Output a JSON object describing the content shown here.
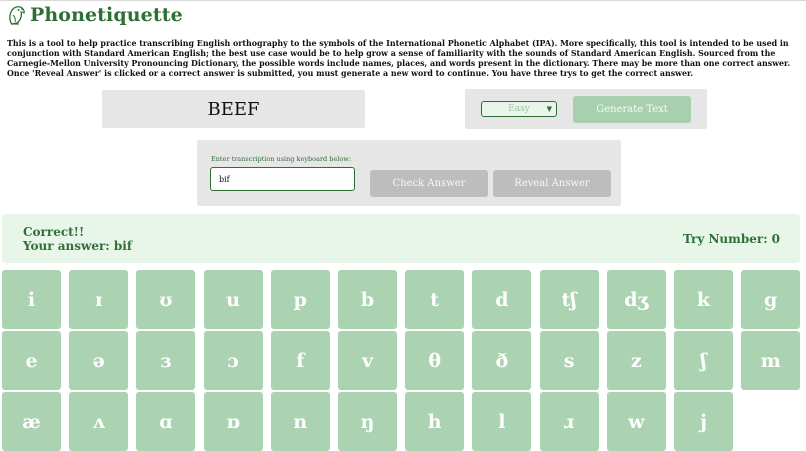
{
  "app": {
    "title": "Phonetiquette"
  },
  "description": "This is a tool to help practice transcribing English orthography to the symbols of the International Phonetic Alphabet (IPA). More specifically, this tool is intended to be used in conjunction with Standard American English; the best use case would be to help grow a sense of familiarity with the sounds of Standard American English. Sourced from the Carnegie-Mellon University Pronouncing Dictionary, the possible words include names, places, and words present in the dictionary. There may be more than one correct answer. Once 'Reveal Answer' is clicked or a correct answer is submitted, you must generate a new word to continue. You have three trys to get the correct answer.",
  "word": "BEEF",
  "controls": {
    "difficulty_selected": "Easy",
    "generate_label": "Generate Text"
  },
  "answer": {
    "label": "Enter transcription using keyboard below:",
    "value": "bif",
    "check_label": "Check Answer",
    "reveal_label": "Reveal Answer"
  },
  "result": {
    "status": "Correct!!",
    "your_answer": "Your answer: bif",
    "try_label": "Try Number:",
    "try_number": "0"
  },
  "keyboard": {
    "rows": [
      [
        "i",
        "ɪ",
        "ʊ",
        "u",
        "p",
        "b",
        "t",
        "d",
        "tʃ",
        "dʒ",
        "k",
        "g"
      ],
      [
        "e",
        "ə",
        "ɜ",
        "ɔ",
        "f",
        "v",
        "θ",
        "ð",
        "s",
        "z",
        "ʃ",
        "m"
      ],
      [
        "æ",
        "ʌ",
        "ɑ",
        "ɒ",
        "n",
        "ŋ",
        "h",
        "l",
        "ɹ",
        "w",
        "j"
      ]
    ]
  },
  "colors": {
    "brand_green": "#2f6f35",
    "key_green": "#abd2b1",
    "button_green": "#a8d0ae",
    "panel_gray": "#e6e6e6",
    "disabled_gray": "#bdbdbd",
    "result_bg": "#e8f6ea"
  }
}
